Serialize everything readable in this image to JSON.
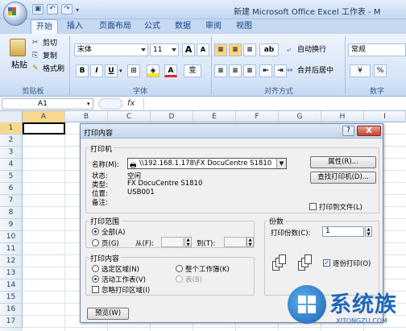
{
  "window": {
    "title": "新建 Microsoft Office Excel 工作表 - M",
    "qat_icons": [
      "save-icon",
      "undo-icon",
      "redo-icon",
      "customize-icon"
    ]
  },
  "ribbon": {
    "tabs": [
      "开始",
      "插入",
      "页面布局",
      "公式",
      "数据",
      "审阅",
      "视图"
    ],
    "active_tab": "开始",
    "clipboard": {
      "paste": "粘贴",
      "cut": "剪切",
      "copy": "复制",
      "format_painter": "格式刷",
      "label": "剪贴板"
    },
    "font": {
      "name": "宋体",
      "size": "11",
      "grow": "A",
      "shrink": "A",
      "bold": "B",
      "italic": "I",
      "underline": "U",
      "color_letter": "A",
      "phonetic": "变",
      "label": "字体"
    },
    "alignment": {
      "wrap": "自动换行",
      "merge": "合并后居中",
      "label": "对齐方式"
    },
    "number": {
      "format": "常规",
      "label": "数字",
      "percent": "%"
    }
  },
  "formula_bar": {
    "name_box": "A1",
    "fx": "fx"
  },
  "sheet": {
    "columns": [
      "A",
      "B",
      "C",
      "D",
      "E",
      "F",
      "G",
      "H",
      "I"
    ],
    "rows": [
      "1",
      "2",
      "3",
      "4",
      "5",
      "6",
      "7",
      "8",
      "9",
      "10",
      "11",
      "12",
      "13",
      "14",
      "15",
      "16",
      "17"
    ],
    "active_cell": "A1"
  },
  "dialog": {
    "title": "打印内容",
    "help": "?",
    "close": "X",
    "printer_group": "打印机",
    "name_label": "名称(M):",
    "printer_name": "\\\\192.168.1.178\\FX DocuCentre S1810",
    "properties_btn": "属性(R)...",
    "find_printer_btn": "查找打印机(D)...",
    "status_label": "状态:",
    "status_value": "空闲",
    "type_label": "类型:",
    "type_value": "FX DocuCentre S1810",
    "where_label": "位置:",
    "where_value": "USB001",
    "comment_label": "备注:",
    "print_to_file": "打印到文件(L)",
    "range_group": "打印范围",
    "range_all": "全部(A)",
    "range_pages": "页(G)",
    "from_label": "从(F):",
    "to_label": "到(T):",
    "copies_group": "份数",
    "copies_label": "打印份数(C):",
    "copies_value": "1",
    "what_group": "打印内容",
    "what_selection": "选定区域(N)",
    "what_workbook": "整个工作簿(K)",
    "what_active": "活动工作表(V)",
    "what_table": "表(B)",
    "ignore_areas": "忽略打印区域(I)",
    "collate": "逐份打印(O)",
    "preview_btn": "预览(W)"
  },
  "watermark": {
    "text": "系统族",
    "url": "XITONGZU.COM"
  }
}
